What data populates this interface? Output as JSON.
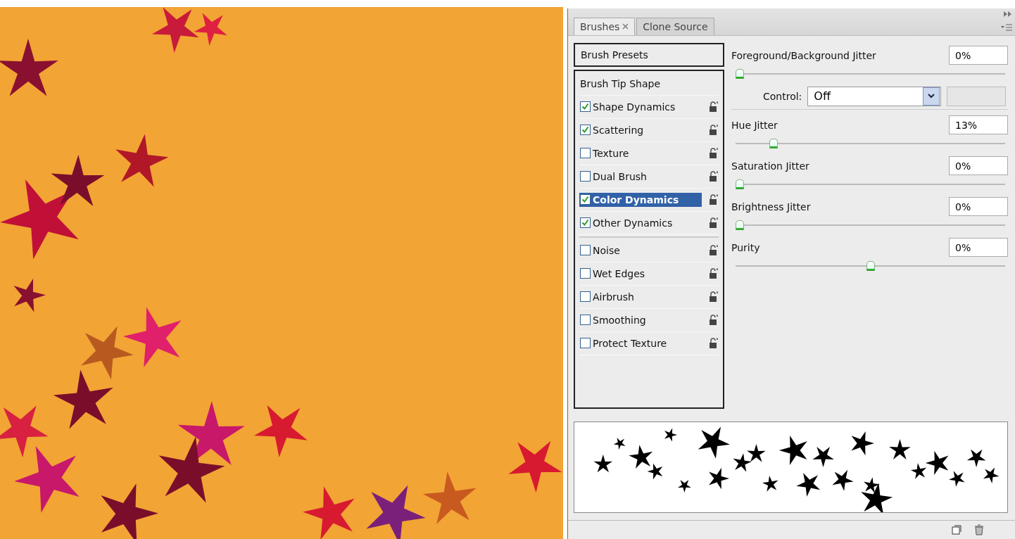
{
  "tabs": [
    {
      "label": "Brushes",
      "selected": true,
      "closable": true
    },
    {
      "label": "Clone Source",
      "selected": false,
      "closable": false
    }
  ],
  "brush_presets": "Brush Presets",
  "option_groups": [
    [
      {
        "kind": "plain",
        "label": "Brush Tip Shape"
      },
      {
        "kind": "option",
        "label": "Shape Dynamics",
        "checked": true,
        "selected": false
      },
      {
        "kind": "option",
        "label": "Scattering",
        "checked": true,
        "selected": false
      },
      {
        "kind": "option",
        "label": "Texture",
        "checked": false,
        "selected": false
      },
      {
        "kind": "option",
        "label": "Dual Brush",
        "checked": false,
        "selected": false
      },
      {
        "kind": "option",
        "label": "Color Dynamics",
        "checked": true,
        "selected": true
      },
      {
        "kind": "option",
        "label": "Other Dynamics",
        "checked": true,
        "selected": false
      }
    ],
    [
      {
        "kind": "option",
        "label": "Noise",
        "checked": false,
        "selected": false
      },
      {
        "kind": "option",
        "label": "Wet Edges",
        "checked": false,
        "selected": false
      },
      {
        "kind": "option",
        "label": "Airbrush",
        "checked": false,
        "selected": false
      },
      {
        "kind": "option",
        "label": "Smoothing",
        "checked": false,
        "selected": false
      },
      {
        "kind": "option",
        "label": "Protect Texture",
        "checked": false,
        "selected": false
      }
    ]
  ],
  "settings": [
    {
      "kind": "slider",
      "label": "Foreground/Background Jitter",
      "value": "0%",
      "level": 0
    },
    {
      "kind": "control",
      "label": "Control:",
      "value": "Off"
    },
    {
      "kind": "slider",
      "label": "Hue Jitter",
      "value": "13%",
      "level": 0.13
    },
    {
      "kind": "slider",
      "label": "Saturation Jitter",
      "value": "0%",
      "level": 0
    },
    {
      "kind": "slider",
      "label": "Brightness Jitter",
      "value": "0%",
      "level": 0
    },
    {
      "kind": "slider",
      "label": "Purity",
      "value": "0%",
      "level": 0.5
    }
  ]
}
